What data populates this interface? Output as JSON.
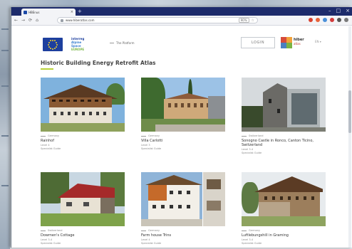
{
  "browser": {
    "tab_title": "HBEnus",
    "tab_close": "×",
    "new_tab": "+",
    "win_controls": [
      "–",
      "□",
      "×"
    ],
    "nav": [
      "←",
      "→",
      "⟳",
      "⌂"
    ],
    "url": "www.hiberatlas.com",
    "zoom": "90%",
    "star": "☆",
    "ext_colors": [
      "#d9412f",
      "#e8633a",
      "#4a90d9",
      "#d33b3b",
      "#555555",
      "#7a7a7a"
    ]
  },
  "header": {
    "interreg": [
      "interreg",
      "Alpine Space",
      "EUROPE"
    ],
    "nav_link": "The Platform",
    "login_label": "LOGIN",
    "brand": "hiber",
    "brand_sub": "atlas",
    "lang": "EN ▾"
  },
  "main": {
    "title": "Historic Building Energy Retrofit Atlas"
  },
  "cards": [
    {
      "kicker": "Germany",
      "name": "Rainhof",
      "meta": [
        "Level 4",
        "Specialist Guide"
      ]
    },
    {
      "kicker": "Germany",
      "name": "Villa Carlotti",
      "meta": [
        "Level 3",
        "Specialist Guide"
      ]
    },
    {
      "kicker": "Switzerland",
      "name": "Sonogno Castle in Ronco, Canton Ticino, Switzerland",
      "meta": [
        "Level 3-4",
        "Specialist Guide"
      ]
    },
    {
      "kicker": "Switzerland",
      "name": "Dowmen's Cottage",
      "meta": [
        "Level 3-4",
        "Specialist Guide"
      ]
    },
    {
      "kicker": "Germany",
      "name": "Farm house Trins",
      "meta": [
        "Level 4",
        "Specialist Guide"
      ]
    },
    {
      "kicker": "Germany",
      "name": "Luftlebungshill in Graming",
      "meta": [
        "Level 3-4",
        "Specialist Guide"
      ]
    }
  ]
}
